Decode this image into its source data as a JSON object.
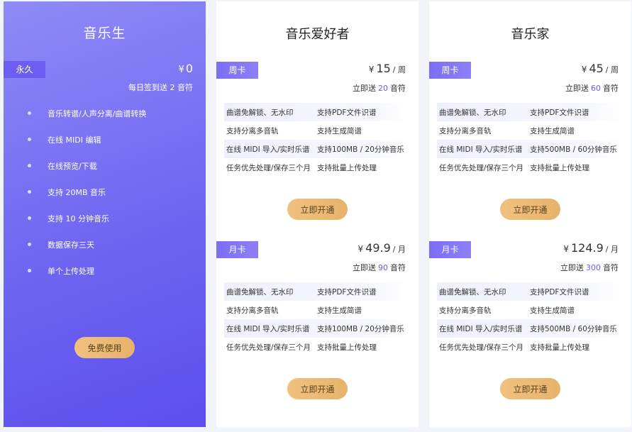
{
  "free": {
    "title": "音乐生",
    "tag": "永久",
    "currency": "¥",
    "price": "0",
    "subtitle": "每日签到送 2 音符",
    "features": [
      "音乐转谱/人声分离/曲谱转换",
      "在线 MIDI 编辑",
      "在线预览/下载",
      "支持 20MB 音乐",
      "支持 10 分钟音乐",
      "数据保存三天",
      "单个上传处理"
    ],
    "button": "免费使用"
  },
  "plans": [
    {
      "title": "音乐爱好者",
      "tiers": [
        {
          "tag": "周卡",
          "currency": "¥",
          "price": "15",
          "per": "/ 周",
          "bonus_prefix": "立即送",
          "bonus_num": "20",
          "bonus_suffix": "音符",
          "rows": [
            [
              "曲谱免解锁、无水印",
              "支持PDF文件识谱"
            ],
            [
              "支持分离多音轨",
              "支持生成简谱"
            ],
            [
              "在线 MIDI 导入/实时乐谱",
              "支持100MB / 20分钟音乐"
            ],
            [
              "任务优先处理/保存三个月",
              "支持批量上传处理"
            ]
          ],
          "button": "立即开通"
        },
        {
          "tag": "月卡",
          "currency": "¥",
          "price": "49.9",
          "per": "/ 月",
          "bonus_prefix": "立即送",
          "bonus_num": "90",
          "bonus_suffix": "音符",
          "rows": [
            [
              "曲谱免解锁、无水印",
              "支持PDF文件识谱"
            ],
            [
              "支持分离多音轨",
              "支持生成简谱"
            ],
            [
              "在线 MIDI 导入/实时乐谱",
              "支持100MB / 20分钟音乐"
            ],
            [
              "任务优先处理/保存三个月",
              "支持批量上传处理"
            ]
          ],
          "button": "立即开通"
        }
      ]
    },
    {
      "title": "音乐家",
      "tiers": [
        {
          "tag": "周卡",
          "currency": "¥",
          "price": "45",
          "per": "/ 周",
          "bonus_prefix": "立即送",
          "bonus_num": "60",
          "bonus_suffix": "音符",
          "rows": [
            [
              "曲谱免解锁、无水印",
              "支持PDF文件识谱"
            ],
            [
              "支持分离多音轨",
              "支持生成简谱"
            ],
            [
              "在线 MIDI 导入/实时乐谱",
              "支持500MB / 60分钟音乐"
            ],
            [
              "任务优先处理/保存三个月",
              "支持批量上传处理"
            ]
          ],
          "button": "立即开通"
        },
        {
          "tag": "月卡",
          "currency": "¥",
          "price": "124.9",
          "per": "/ 月",
          "bonus_prefix": "立即送",
          "bonus_num": "300",
          "bonus_suffix": "音符",
          "rows": [
            [
              "曲谱免解锁、无水印",
              "支持PDF文件识谱"
            ],
            [
              "支持分离多音轨",
              "支持生成简谱"
            ],
            [
              "在线 MIDI 导入/实时乐谱",
              "支持500MB / 60分钟音乐"
            ],
            [
              "任务优先处理/保存三个月",
              "支持批量上传处理"
            ]
          ],
          "button": "立即开通"
        }
      ]
    }
  ]
}
